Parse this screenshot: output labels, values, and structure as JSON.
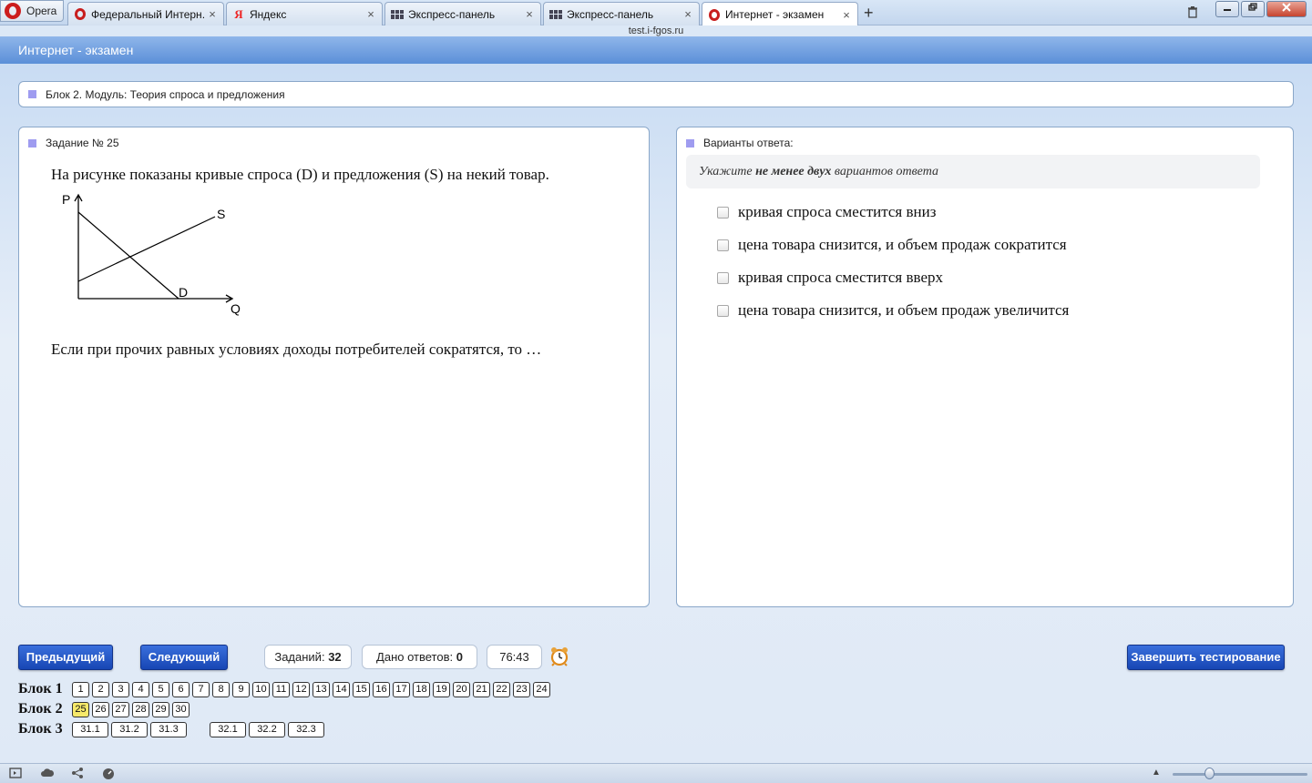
{
  "browser": {
    "menu_label": "Opera",
    "tabs": [
      {
        "label": "Федеральный Интерн...",
        "icon": "opera-icon"
      },
      {
        "label": "Яндекс",
        "icon": "yandex-icon"
      },
      {
        "label": "Экспресс-панель",
        "icon": "speed-dial-icon"
      },
      {
        "label": "Экспресс-панель",
        "icon": "speed-dial-icon"
      },
      {
        "label": "Интернет - экзамен",
        "icon": "opera-icon",
        "active": true
      }
    ],
    "close_glyph": "×",
    "new_tab_glyph": "+",
    "url": "test.i-fgos.ru"
  },
  "app": {
    "title": "Интернет - экзамен"
  },
  "block_header": "Блок 2. Модуль: Теория спроса и предложения",
  "task": {
    "title": "Задание № 25",
    "text1": "На рисунке показаны кривые спроса (D) и предложения (S) на некий товар.",
    "text2": "Если при прочих равных условиях доходы потребителей сократятся, то …",
    "graph_labels": {
      "p": "P",
      "q": "Q",
      "s": "S",
      "d": "D"
    }
  },
  "answers": {
    "title": "Варианты ответа:",
    "hint_pre": "Укажите",
    "hint_bold": "не менее двух",
    "hint_post": "вариантов ответа",
    "options": [
      "кривая спроса сместится вниз",
      "цена товара снизится, и объем продаж сократится",
      "кривая спроса сместится вверх",
      "цена товара снизится, и объем продаж увеличится"
    ]
  },
  "controls": {
    "prev": "Предыдущий",
    "next": "Следующий",
    "tasks_label": "Заданий:",
    "tasks_count": "32",
    "answers_label": "Дано ответов:",
    "answers_count": "0",
    "timer": "76:43",
    "finish": "Завершить тестирование"
  },
  "nav": {
    "block1_label": "Блок 1",
    "block1": [
      "1",
      "2",
      "3",
      "4",
      "5",
      "6",
      "7",
      "8",
      "9",
      "10",
      "11",
      "12",
      "13",
      "14",
      "15",
      "16",
      "17",
      "18",
      "19",
      "20",
      "21",
      "22",
      "23",
      "24"
    ],
    "block2_label": "Блок 2",
    "block2": [
      "25",
      "26",
      "27",
      "28",
      "29",
      "30"
    ],
    "block2_current": "25",
    "block3_label": "Блок 3",
    "block3a": [
      "31.1",
      "31.2",
      "31.3"
    ],
    "block3b": [
      "32.1",
      "32.2",
      "32.3"
    ]
  },
  "colors": {
    "accent_button": "#1746b4",
    "current_task": "#f6e96a",
    "panel_bullet": "#9f9cf0"
  }
}
